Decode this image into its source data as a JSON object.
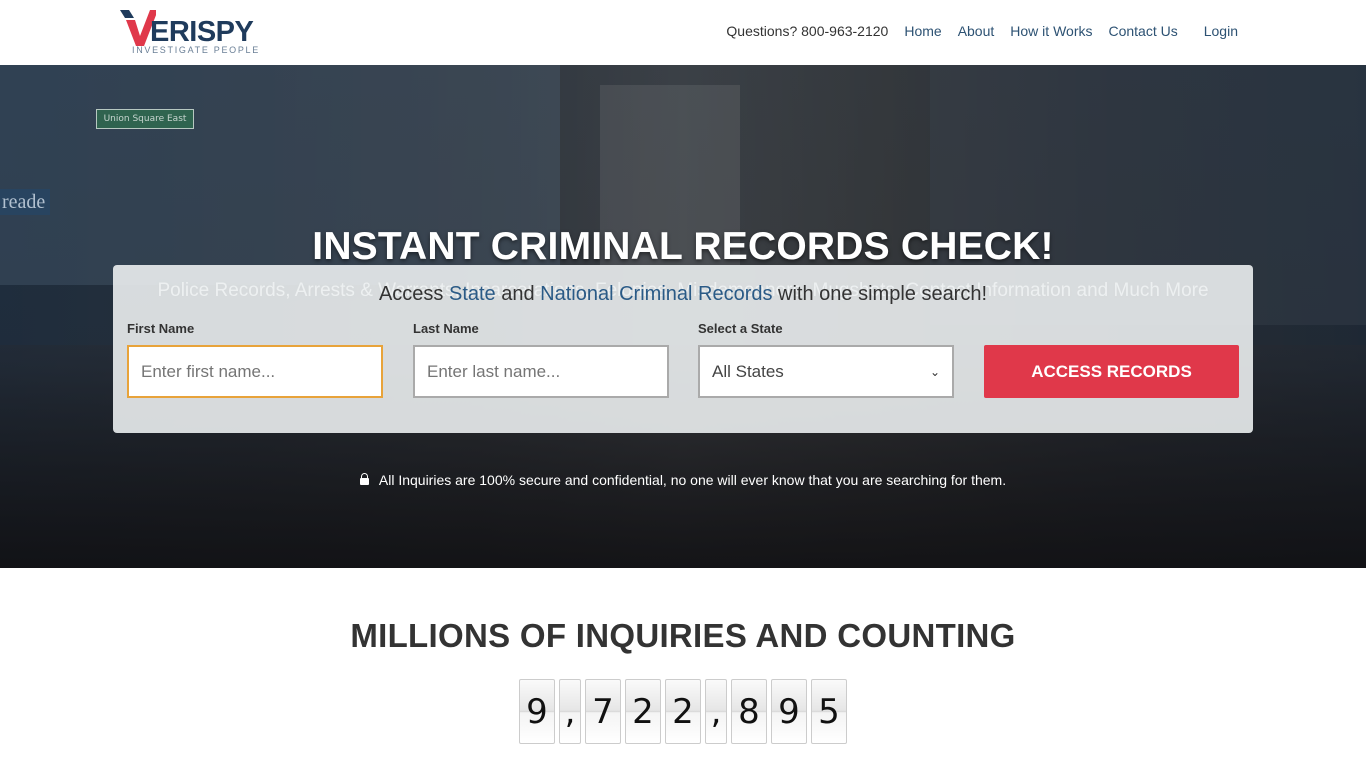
{
  "header": {
    "logo": {
      "brand": "ERISPY",
      "mark_letter": "V",
      "tagline": "INVESTIGATE PEOPLE",
      "colors": {
        "red": "#e0384a",
        "navy": "#1f3b5c"
      }
    },
    "phone": "Questions? 800-963-2120",
    "nav": [
      {
        "label": "Home"
      },
      {
        "label": "About"
      },
      {
        "label": "How it Works"
      },
      {
        "label": "Contact Us"
      },
      {
        "label": "Login"
      }
    ]
  },
  "hero": {
    "background_signs": {
      "street_sign": "Union Square East",
      "store_sign": "reade"
    },
    "title": "INSTANT CRIMINAL RECORDS CHECK!",
    "subtitle": "Police Records, Arrests & Warrants, Incarcerations, Felonies, Misdemeanors, Mugshots, Contact Information and Much More",
    "search": {
      "heading_parts": [
        "Access ",
        "State",
        " and ",
        "National Criminal Records",
        " with one simple search!"
      ],
      "first_name": {
        "label": "First Name",
        "placeholder": "Enter first name...",
        "value": ""
      },
      "last_name": {
        "label": "Last Name",
        "placeholder": "Enter last name...",
        "value": ""
      },
      "state": {
        "label": "Select a State",
        "selected": "All States"
      },
      "submit_label": "ACCESS RECORDS",
      "accent_color": "#e0384a"
    },
    "secure_note": "All Inquiries are 100% secure and confidential, no one will ever know that you are searching for them."
  },
  "counter": {
    "title": "MILLIONS OF INQUIRIES AND COUNTING",
    "value": "9,722,895",
    "chars": [
      "9",
      ",",
      "7",
      "2",
      "2",
      ",",
      "8",
      "9",
      "5"
    ]
  }
}
